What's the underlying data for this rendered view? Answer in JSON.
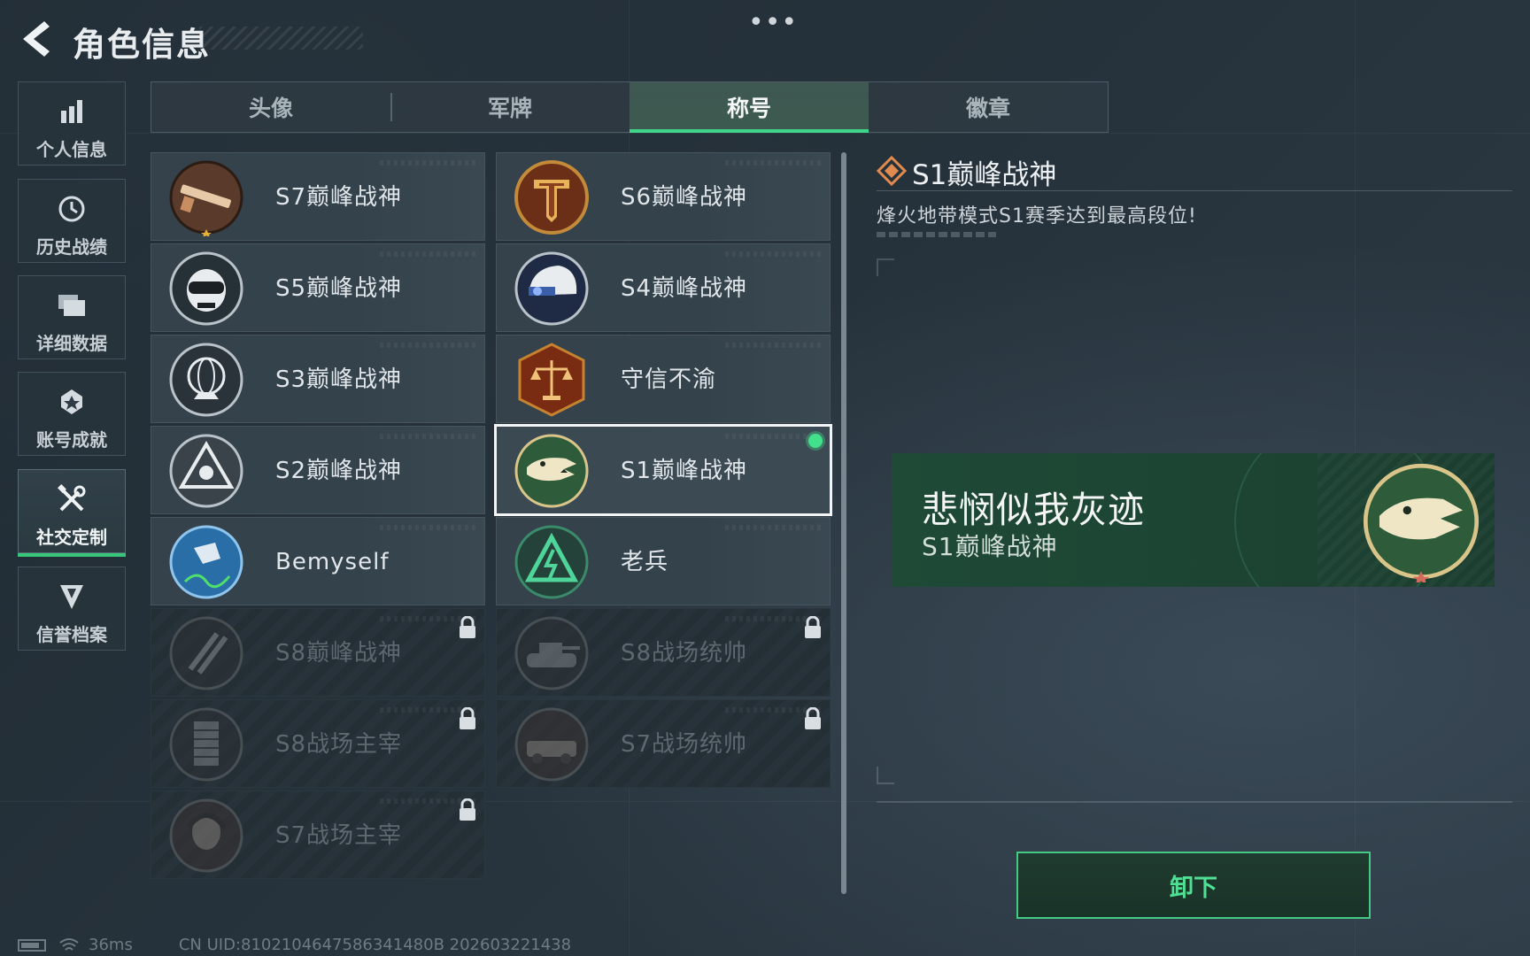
{
  "header": {
    "title": "角色信息",
    "more": "•••"
  },
  "sidebar": {
    "items": [
      {
        "label": "个人信息",
        "icon": "bar-chart-icon",
        "active": false
      },
      {
        "label": "历史战绩",
        "icon": "history-icon",
        "active": false
      },
      {
        "label": "详细数据",
        "icon": "folder-icon",
        "active": false
      },
      {
        "label": "账号成就",
        "icon": "medal-icon",
        "active": false
      },
      {
        "label": "社交定制",
        "icon": "tools-icon",
        "active": true
      },
      {
        "label": "信誉档案",
        "icon": "shield-icon",
        "active": false
      }
    ]
  },
  "tabs": [
    {
      "label": "头像",
      "active": false
    },
    {
      "label": "军牌",
      "active": false
    },
    {
      "label": "称号",
      "active": true
    },
    {
      "label": "徽章",
      "active": false
    }
  ],
  "titles": [
    {
      "name": "S7巅峰战神",
      "emblem": "rifle-emblem-icon",
      "locked": false
    },
    {
      "name": "S6巅峰战神",
      "emblem": "t-shield-emblem-icon",
      "locked": false
    },
    {
      "name": "S5巅峰战神",
      "emblem": "skull-mask-emblem-icon",
      "locked": false
    },
    {
      "name": "S4巅峰战神",
      "emblem": "helmet-emblem-icon",
      "locked": false
    },
    {
      "name": "S3巅峰战神",
      "emblem": "globe-emblem-icon",
      "locked": false
    },
    {
      "name": "守信不渝",
      "emblem": "scales-emblem-icon",
      "locked": false
    },
    {
      "name": "S2巅峰战神",
      "emblem": "triangle-emblem-icon",
      "locked": false
    },
    {
      "name": "S1巅峰战神",
      "emblem": "crocodile-emblem-icon",
      "locked": false,
      "selected": true,
      "equipped": true
    },
    {
      "name": "Bemyself",
      "emblem": "signature-emblem-icon",
      "locked": false
    },
    {
      "name": "老兵",
      "emblem": "veteran-emblem-icon",
      "locked": false
    },
    {
      "name": "S8巅峰战神",
      "emblem": "blades-emblem-icon",
      "locked": true
    },
    {
      "name": "S8战场统帅",
      "emblem": "tank-emblem-icon",
      "locked": true
    },
    {
      "name": "S8战场主宰",
      "emblem": "tower-emblem-icon",
      "locked": true
    },
    {
      "name": "S7战场统帅",
      "emblem": "vehicle-emblem-icon",
      "locked": true
    },
    {
      "name": "S7战场主宰",
      "emblem": "warrior-emblem-icon",
      "locked": true
    }
  ],
  "detail": {
    "title": "S1巅峰战神",
    "description": "烽火地带模式S1赛季达到最高段位!",
    "preview": {
      "player_name": "悲悯似我灰迹",
      "title": "S1巅峰战神"
    },
    "action_label": "卸下"
  },
  "footer": {
    "ping": "36ms",
    "uid": "CN UID:8102104647586341480B 202603221438"
  },
  "colors": {
    "accent_green": "#3fd48a",
    "equipped_dot": "#42e08b",
    "title_diamond": "#e08a4f"
  }
}
